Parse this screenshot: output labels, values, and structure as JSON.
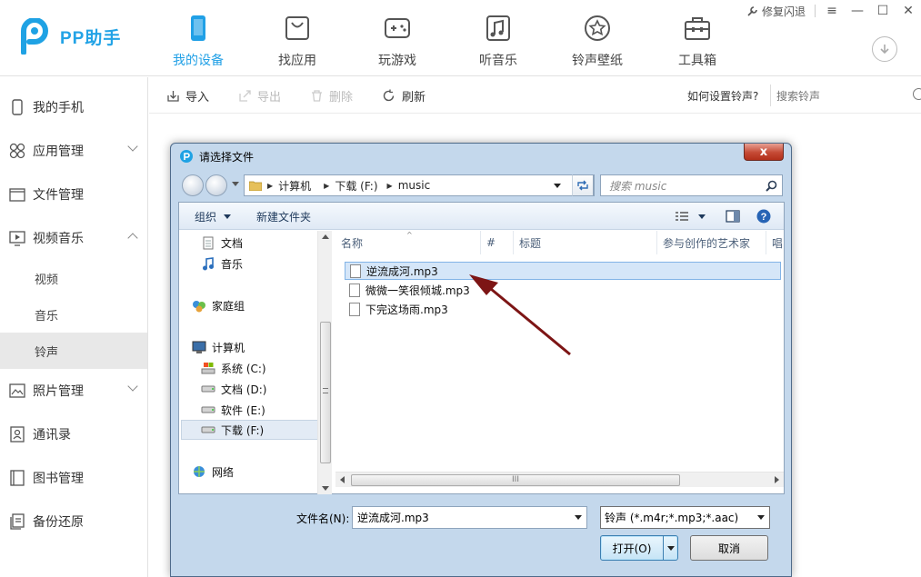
{
  "app": {
    "name": "PP助手",
    "brand_color": "#21a0e6"
  },
  "window": {
    "repair_label": "修复闪退",
    "minimize": "—",
    "maximize": "☐",
    "close": "✕",
    "menu": "≡"
  },
  "nav": {
    "tabs": [
      {
        "label": "我的设备",
        "icon": "phone-icon",
        "active": true
      },
      {
        "label": "找应用",
        "icon": "shopping-bag-icon"
      },
      {
        "label": "玩游戏",
        "icon": "gamepad-icon"
      },
      {
        "label": "听音乐",
        "icon": "music-icon"
      },
      {
        "label": "铃声壁纸",
        "icon": "star-icon"
      },
      {
        "label": "工具箱",
        "icon": "toolbox-icon"
      }
    ]
  },
  "sidebar": {
    "items": [
      {
        "label": "我的手机",
        "icon": "phone-icon"
      },
      {
        "label": "应用管理",
        "icon": "apps-icon"
      },
      {
        "label": "文件管理",
        "icon": "folder-icon"
      },
      {
        "label": "视频音乐",
        "icon": "media-icon"
      },
      {
        "label": "照片管理",
        "icon": "photo-icon"
      },
      {
        "label": "通讯录",
        "icon": "contacts-icon"
      },
      {
        "label": "图书管理",
        "icon": "book-icon"
      },
      {
        "label": "备份还原",
        "icon": "backup-icon"
      }
    ],
    "sub_items": [
      {
        "label": "视频"
      },
      {
        "label": "音乐"
      },
      {
        "label": "铃声",
        "active": true
      }
    ]
  },
  "toolbar": {
    "import": "导入",
    "export": "导出",
    "delete": "删除",
    "refresh": "刷新",
    "help": "如何设置铃声?",
    "search_placeholder": "搜索铃声"
  },
  "dialog": {
    "title": "请选择文件",
    "close": "x",
    "address": {
      "crumbs": [
        "计算机",
        "下载 (F:)",
        "music"
      ]
    },
    "search_placeholder": "搜索 music",
    "cmdbar": {
      "organize": "组织",
      "new_folder": "新建文件夹"
    },
    "nav_tree": [
      {
        "label": "文档",
        "icon": "document-icon"
      },
      {
        "label": "音乐",
        "icon": "music-note-icon"
      },
      {
        "label": "家庭组",
        "icon": "homegroup-icon"
      },
      {
        "label": "计算机",
        "icon": "computer-icon"
      },
      {
        "label": "系统 (C:)",
        "icon": "system-drive-icon"
      },
      {
        "label": "文档 (D:)",
        "icon": "drive-icon"
      },
      {
        "label": "软件 (E:)",
        "icon": "drive-icon"
      },
      {
        "label": "下载 (F:)",
        "icon": "drive-icon",
        "selected": true
      },
      {
        "label": "网络",
        "icon": "network-icon"
      }
    ],
    "columns": [
      "名称",
      "#",
      "标题",
      "参与创作的艺术家",
      "唱"
    ],
    "files": [
      {
        "name": "逆流成河.mp3",
        "selected": true
      },
      {
        "name": "微微一笑很倾城.mp3"
      },
      {
        "name": "下完这场雨.mp3"
      }
    ],
    "scroll_grip": "III",
    "filename_label": "文件名(N):",
    "filename_value": "逆流成河.mp3",
    "filter_value": "铃声 (*.m4r;*.mp3;*.aac)",
    "open_button": "打开(O)",
    "cancel_button": "取消"
  }
}
